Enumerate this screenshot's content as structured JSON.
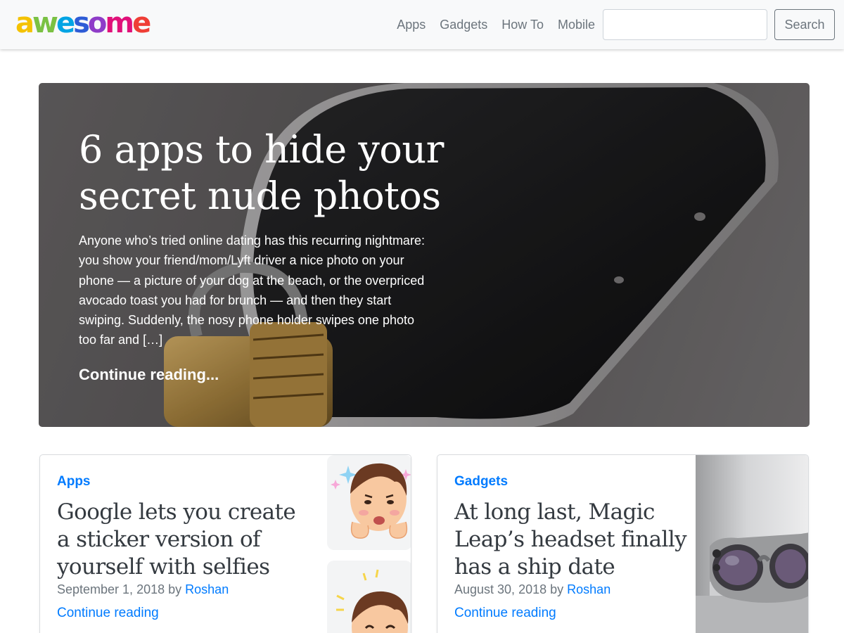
{
  "brand": {
    "logo_letters": [
      "a",
      "w",
      "e",
      "s",
      "o",
      "m",
      "e"
    ],
    "logo_colors": [
      "#f4c200",
      "#7ac143",
      "#00a4e4",
      "#2e5cd6",
      "#8e3cc8",
      "#e0117a",
      "#ef3e36"
    ]
  },
  "nav": {
    "links": [
      "Apps",
      "Gadgets",
      "How To",
      "Mobile"
    ],
    "search_placeholder": "",
    "search_button": "Search"
  },
  "hero": {
    "title": "6 apps to hide your secret nude photos",
    "excerpt": "Anyone who’s tried online dating has this recurring nightmare: you show your friend/mom/Lyft driver a nice photo on your phone — a picture of your dog at the beach, or the overpriced avocado toast you had for brunch — and then they start swiping. Suddenly, the nosy phone holder swipes one photo too far and […]",
    "link": "Continue reading...",
    "image_icon": "phone-with-padlock-image"
  },
  "cards": [
    {
      "category": "Apps",
      "title": "Google lets you create a sticker version of yourself with selfies",
      "date": "September 1, 2018",
      "by": "by",
      "author": "Roshan",
      "continue": "Continue reading",
      "image_icon": "cartoon-sticker-image"
    },
    {
      "category": "Gadgets",
      "title": "At long last, Magic Leap’s headset finally has a ship date",
      "date": "August 30, 2018",
      "by": "by",
      "author": "Roshan",
      "continue": "Continue reading",
      "image_icon": "ar-headset-image"
    }
  ],
  "colors": {
    "link": "#007bff",
    "muted": "#6c757d",
    "navbar_bg": "#f8f9fa"
  }
}
